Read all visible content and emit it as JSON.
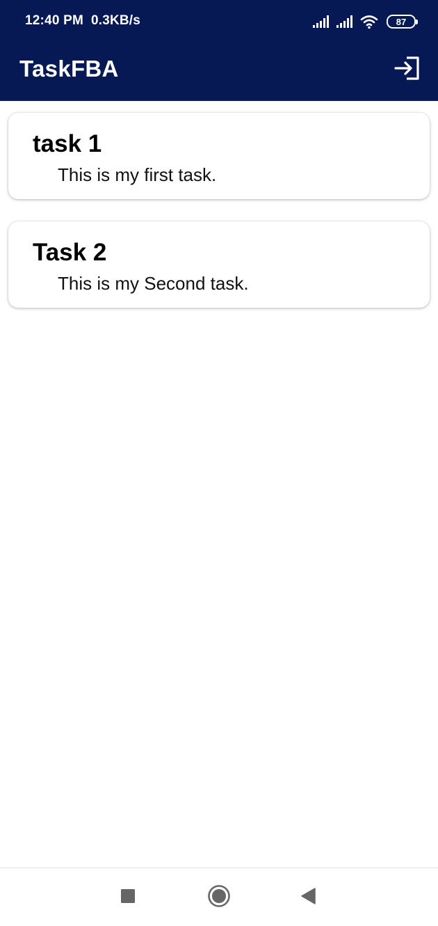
{
  "status_bar": {
    "time": "12:40 PM",
    "speed": "0.3KB/s",
    "battery": "87",
    "icons": [
      "signal-icon",
      "signal-icon",
      "wifi-icon",
      "battery-icon"
    ]
  },
  "app_bar": {
    "title": "TaskFBA",
    "action_icon": "logout-icon"
  },
  "tasks": [
    {
      "title": "task 1",
      "description": "This is my first task."
    },
    {
      "title": "Task 2",
      "description": "This is my Second task."
    }
  ],
  "nav_bar": {
    "icons": [
      "recents-icon",
      "home-icon",
      "back-icon"
    ]
  },
  "colors": {
    "app_bar_bg": "#061955",
    "text_on_bar": "#ffffff",
    "card_bg": "#ffffff",
    "nav_icon": "#666666"
  }
}
